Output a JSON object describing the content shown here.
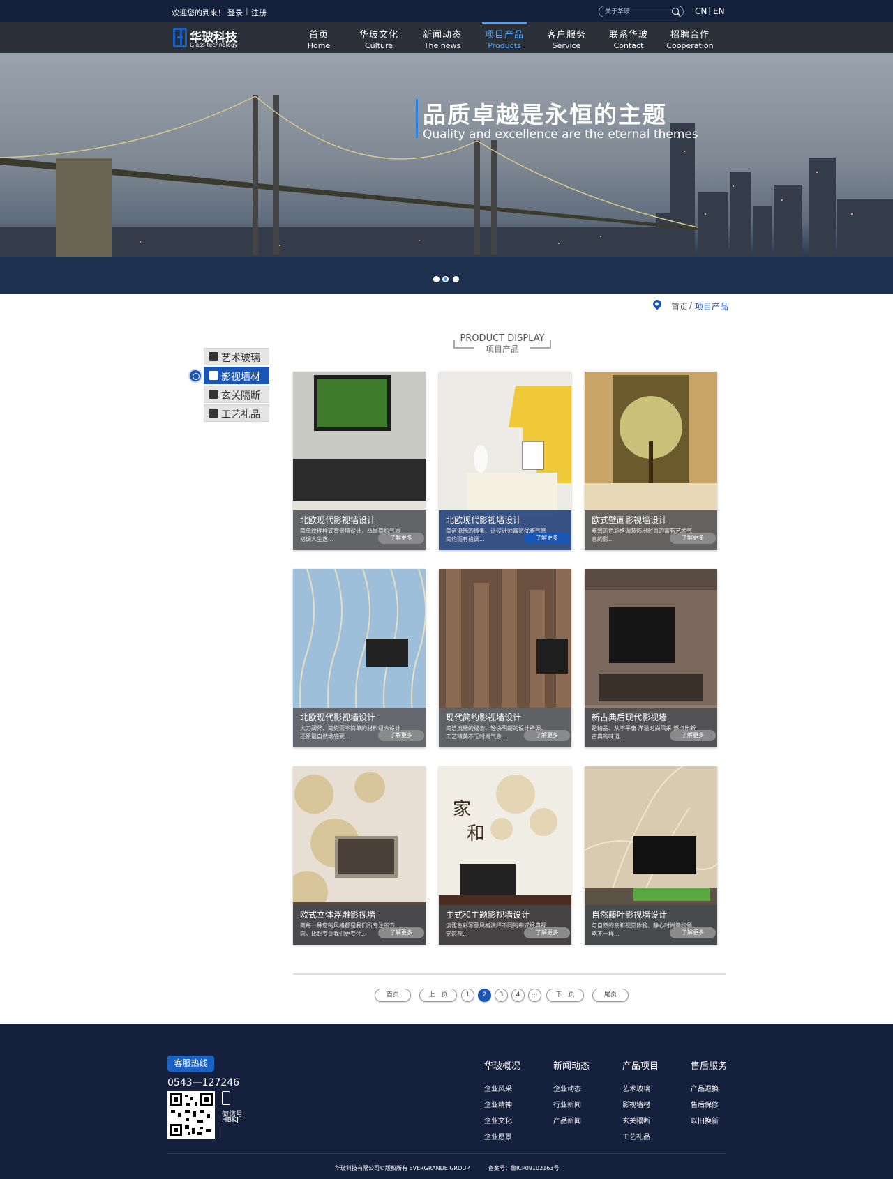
{
  "topbar": {
    "welcome": "欢迎您的到来！",
    "login": "登录",
    "sep": "|",
    "register": "注册",
    "search_placeholder": "关于华玻",
    "lang_cn": "CN",
    "lang_sep": "|",
    "lang_en": "EN"
  },
  "logo": {
    "cn": "华玻科技",
    "en": "Glass technology"
  },
  "nav": [
    {
      "zh": "首页",
      "en": "Home"
    },
    {
      "zh": "华玻文化",
      "en": "Culture"
    },
    {
      "zh": "新闻动态",
      "en": "The news"
    },
    {
      "zh": "项目产品",
      "en": "Products",
      "active": true
    },
    {
      "zh": "客户服务",
      "en": "Service"
    },
    {
      "zh": "联系华玻",
      "en": "Contact"
    },
    {
      "zh": "招聘合作",
      "en": "Cooperation"
    }
  ],
  "banner": {
    "title": "品质卓越是永恒的主题",
    "subtitle": "Quality and excellence are the eternal themes",
    "slides": 3,
    "active_slide": 2
  },
  "breadcrumb": {
    "home": "首页",
    "sep": "/",
    "current": "项目产品"
  },
  "section": {
    "en": "PRODUCT DISPLAY",
    "zh": "项目产品"
  },
  "sidebar": [
    {
      "label": "艺术玻璃"
    },
    {
      "label": "影视墙材",
      "active": true
    },
    {
      "label": "玄关隔断"
    },
    {
      "label": "工艺礼品"
    }
  ],
  "products": [
    {
      "title": "北欧现代影视墙设计",
      "desc": "简单纹理样式背景墙设计，凸显简约气质格调人生选...",
      "more": "了解更多"
    },
    {
      "title": "北欧现代影视墙设计",
      "desc": "简洁流畅的线条、让设计师富裕优雅气息简约而有格调...",
      "more": "了解更多",
      "active": true
    },
    {
      "title": "欧式壁画影视墙设计",
      "desc": "雅致的色彩格调装饰出时尚的富有艺术气息的影...",
      "more": "了解更多"
    },
    {
      "title": "北欧现代影视墙设计",
      "desc": "大刀阔斧、简约而不简单的材料组合设计还原最自然地感受...",
      "more": "了解更多"
    },
    {
      "title": "现代简约影视墙设计",
      "desc": "简洁流畅的线条、轻快明朗的设计格调，工艺精美不乏时尚气息...",
      "more": "了解更多"
    },
    {
      "title": "新古典后现代影视墙",
      "desc": "是精品、从不平庸 洋溢时尚风采 燃点出新古典的味道...",
      "more": "了解更多"
    },
    {
      "title": "欧式立体浮雕影视墙",
      "desc": "简每一种您的风格都是我们所专注的方向，比起专业我们更专注...",
      "more": "了解更多"
    },
    {
      "title": "中式和主题影视墙设计",
      "desc": "淡雅色彩写意风格演绎不同的中式经典视觉影视...",
      "more": "了解更多"
    },
    {
      "title": "自然藤叶影视墙设计",
      "desc": "与自然的亲和视觉体验、静心时尚简约领略不一样...",
      "more": "了解更多"
    }
  ],
  "pagination": {
    "first": "首页",
    "prev": "上一页",
    "pages": [
      "1",
      "2",
      "3",
      "4"
    ],
    "current": "2",
    "ellipsis": "···",
    "next": "下一页",
    "last": "尾页"
  },
  "footer": {
    "hotline_label": "客服热线",
    "hotline": "0543—127246",
    "wechat_label": "微信号",
    "wechat_id": "HBKJ",
    "columns": [
      {
        "title": "华玻概况",
        "links": [
          "企业风采",
          "企业精神",
          "企业文化",
          "企业愿景"
        ]
      },
      {
        "title": "新闻动态",
        "links": [
          "企业动态",
          "行业新闻",
          "产品新闻"
        ]
      },
      {
        "title": "产品项目",
        "links": [
          "艺术玻璃",
          "影视墙材",
          "玄关隔断",
          "工艺礼品"
        ]
      },
      {
        "title": "售后服务",
        "links": [
          "产品退换",
          "售后保修",
          "以旧换新"
        ]
      }
    ],
    "copyright": "华玻科技有限公司©版权所有 EVERGRANDE GROUP",
    "icp": "备案号：鲁ICP09102163号"
  },
  "colors": {
    "primary": "#1a56b8",
    "topbar": "#15203d",
    "nav": "#2a2f38",
    "active_nav": "#4aa3ff"
  }
}
